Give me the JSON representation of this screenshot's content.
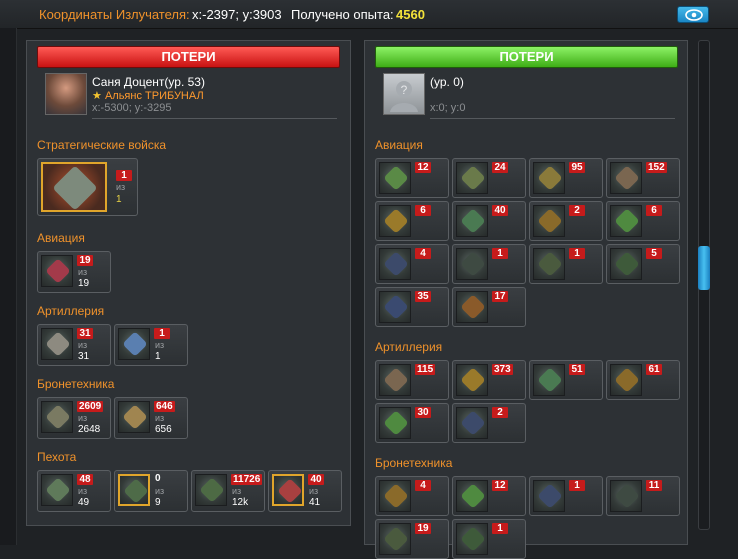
{
  "topbar": {
    "coords_label": "Координаты Излучателя:",
    "coords_value": "x:-2397; y:3903",
    "exp_label": "Получено опыта:",
    "exp_value": "4560"
  },
  "colors": {
    "accent_orange": "#f0922b",
    "loss_red": "#c61b1b",
    "exp_yellow": "#f4e33a"
  },
  "left": {
    "header": "ПОТЕРИ",
    "player": {
      "name": "Саня Доцент(ур. 53)",
      "alliance": "Альянс ТРИБУНАЛ",
      "coords": "x:-5300; y:-3295"
    },
    "sections": [
      {
        "title": "Стратегические войска",
        "units": [
          {
            "lost": "1",
            "of": "из",
            "total": "1",
            "icon": "mech-walker-icon"
          }
        ]
      },
      {
        "title": "Авиация",
        "units": [
          {
            "lost": "19",
            "of": "из",
            "total": "19",
            "icon": "red-aircraft-icon"
          }
        ]
      },
      {
        "title": "Артиллерия",
        "units": [
          {
            "lost": "31",
            "of": "из",
            "total": "31",
            "icon": "artillery-icon"
          },
          {
            "lost": "1",
            "of": "из",
            "total": "1",
            "icon": "blue-artillery-icon"
          }
        ]
      },
      {
        "title": "Бронетехника",
        "units": [
          {
            "lost": "2609",
            "of": "из",
            "total": "2648",
            "icon": "tank-icon"
          },
          {
            "lost": "646",
            "of": "из",
            "total": "656",
            "icon": "heavy-tank-icon"
          }
        ]
      },
      {
        "title": "Пехота",
        "units": [
          {
            "lost": "48",
            "of": "из",
            "total": "49",
            "icon": "infantry-icon"
          },
          {
            "lost": "0",
            "of": "из",
            "total": "9",
            "icon": "elite-infantry-icon"
          },
          {
            "lost": "11726",
            "of": "из",
            "total": "12k",
            "icon": "soldier-icon"
          },
          {
            "lost": "40",
            "of": "из",
            "total": "41",
            "icon": "red-cyborg-icon"
          }
        ]
      }
    ]
  },
  "right": {
    "header": "ПОТЕРИ",
    "player": {
      "name": "(ур. 0)",
      "coords": "x:0; y:0"
    },
    "sections": [
      {
        "title": "Авиация",
        "losses": [
          "12",
          "24",
          "95",
          "152",
          "6",
          "40",
          "2",
          "6",
          "4",
          "1",
          "1",
          "5",
          "35",
          "17"
        ]
      },
      {
        "title": "Артиллерия",
        "losses": [
          "115",
          "373",
          "51",
          "61",
          "30",
          "2"
        ]
      },
      {
        "title": "Бронетехника",
        "losses": [
          "4",
          "12",
          "1",
          "11",
          "19",
          "1"
        ]
      }
    ]
  }
}
